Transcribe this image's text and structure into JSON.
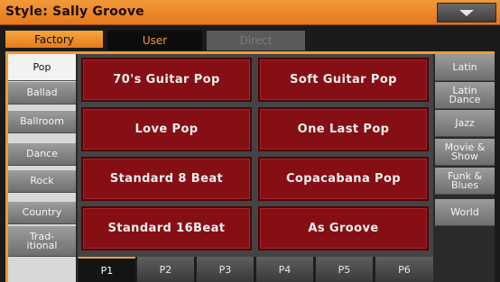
{
  "header": {
    "title": "Style: Sally Groove"
  },
  "tabs": {
    "factory": "Factory",
    "user": "User",
    "direct": "Direct"
  },
  "left_categories": [
    "Pop",
    "Ballad",
    "Ballroom",
    "Dance",
    "Rock",
    "Country",
    "Trad-\nitional"
  ],
  "styles": [
    "70's Guitar Pop",
    "Soft Guitar Pop",
    "Love Pop",
    "One Last Pop",
    "Standard 8 Beat",
    "Copacabana Pop",
    "Standard 16Beat",
    "As Groove"
  ],
  "right_categories": [
    "Latin",
    "Latin\nDance",
    "Jazz",
    "Movie &\nShow",
    "Funk &\nBlues",
    "World"
  ],
  "pages": [
    "P1",
    "P2",
    "P3",
    "P4",
    "P5",
    "P6"
  ],
  "colors": {
    "accent": "#f09a3a",
    "style_button": "#860f16"
  }
}
